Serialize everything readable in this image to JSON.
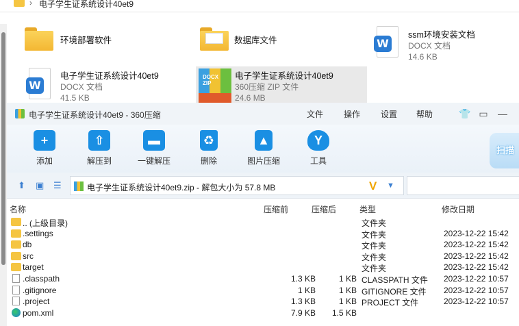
{
  "explorer": {
    "breadcrumb": "电子学生证系统设计40et9",
    "items": [
      {
        "name": "环境部署软件",
        "type": "",
        "size": ""
      },
      {
        "name": "数据库文件",
        "type": "",
        "size": ""
      },
      {
        "name": "ssm环境安装文档",
        "type": "DOCX 文档",
        "size": "14.6 KB"
      },
      {
        "name": "电子学生证系统设计40et9",
        "type": "DOCX 文档",
        "size": "41.5 KB"
      },
      {
        "name": "电子学生证系统设计40et9",
        "type": "360压缩 ZIP 文件",
        "size": "24.6 MB"
      }
    ]
  },
  "window": {
    "title": "电子学生证系统设计40et9 - 360压缩",
    "menus": [
      "文件",
      "操作",
      "设置",
      "帮助"
    ],
    "toolbar": [
      {
        "label": "添加",
        "icon": "add-icon"
      },
      {
        "label": "解压到",
        "icon": "extract-to-icon"
      },
      {
        "label": "一键解压",
        "icon": "one-click-extract-icon"
      },
      {
        "label": "删除",
        "icon": "delete-icon"
      },
      {
        "label": "图片压缩",
        "icon": "image-compress-icon"
      },
      {
        "label": "工具",
        "icon": "tools-icon"
      }
    ],
    "scan_label": "扫描",
    "address": "电子学生证系统设计40et9.zip - 解包大小为 57.8 MB",
    "columns": {
      "name": "名称",
      "compressed_before": "压缩前",
      "compressed_after": "压缩后",
      "type": "类型",
      "modified": "修改日期"
    },
    "rows": [
      {
        "icon": "folder",
        "name": ".. (上级目录)",
        "before": "",
        "after": "",
        "type": "文件夹",
        "date": ""
      },
      {
        "icon": "folder",
        "name": ".settings",
        "before": "",
        "after": "",
        "type": "文件夹",
        "date": "2023-12-22 15:42"
      },
      {
        "icon": "folder",
        "name": "db",
        "before": "",
        "after": "",
        "type": "文件夹",
        "date": "2023-12-22 15:42"
      },
      {
        "icon": "folder",
        "name": "src",
        "before": "",
        "after": "",
        "type": "文件夹",
        "date": "2023-12-22 15:42"
      },
      {
        "icon": "folder",
        "name": "target",
        "before": "",
        "after": "",
        "type": "文件夹",
        "date": "2023-12-22 15:42"
      },
      {
        "icon": "file",
        "name": ".classpath",
        "before": "1.3 KB",
        "after": "1 KB",
        "type": "CLASSPATH 文件",
        "date": "2023-12-22 10:57"
      },
      {
        "icon": "file",
        "name": ".gitignore",
        "before": "1 KB",
        "after": "1 KB",
        "type": "GITIGNORE 文件",
        "date": "2023-12-22 10:57"
      },
      {
        "icon": "file",
        "name": ".project",
        "before": "1.3 KB",
        "after": "1 KB",
        "type": "PROJECT 文件",
        "date": "2023-12-22 10:57"
      },
      {
        "icon": "edge",
        "name": "pom.xml",
        "before": "7.9 KB",
        "after": "1.5 KB",
        "type": "",
        "date": ""
      }
    ]
  }
}
